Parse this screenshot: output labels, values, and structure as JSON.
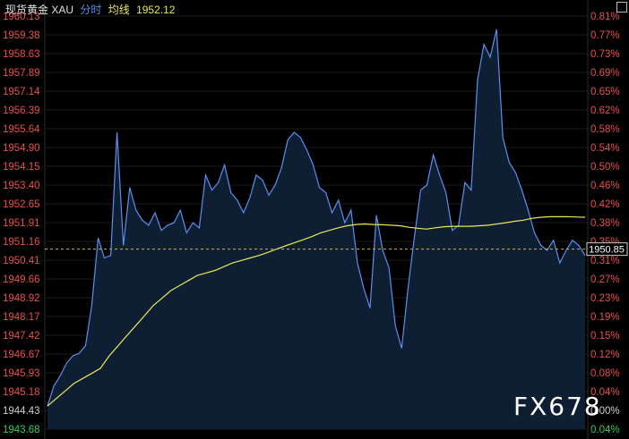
{
  "header": {
    "instrument": "现货黄金 XAU",
    "tab_intraday": "分时",
    "avg_label": "均线",
    "avg_value": "1952.12"
  },
  "watermark": "FX678",
  "colors": {
    "background": "#000000",
    "price_line": "#5b8ff0",
    "avg_line": "#e8e85a",
    "up_axis": "#e8504d",
    "down_axis": "#2fcf5c",
    "neutral_axis": "#cfcfcf",
    "ref_line": "#d6b04a",
    "fill": "#0f1f33"
  },
  "chart_data": {
    "type": "line",
    "title": "现货黄金 XAU",
    "ylim": [
      1943.68,
      1960.13
    ],
    "prev_close": 1944.43,
    "last_price": "1950.85",
    "left_ticks": [
      "1960.13",
      "1959.38",
      "1958.63",
      "1957.89",
      "1957.14",
      "1956.39",
      "1955.64",
      "1954.90",
      "1954.15",
      "1953.40",
      "1952.65",
      "1951.91",
      "1951.16",
      "1950.41",
      "1949.66",
      "1948.92",
      "1948.17",
      "1947.42",
      "1946.67",
      "1945.93",
      "1945.18",
      "1944.43",
      "1943.68"
    ],
    "right_ticks": [
      "0.81%",
      "0.77%",
      "0.73%",
      "0.69%",
      "0.65%",
      "0.62%",
      "0.58%",
      "0.54%",
      "0.50%",
      "0.46%",
      "0.42%",
      "0.38%",
      "0.35%",
      "0.31%",
      "0.27%",
      "0.23%",
      "0.19%",
      "0.15%",
      "0.12%",
      "0.08%",
      "0.04%",
      "0.00%",
      "0.04%"
    ],
    "series": [
      {
        "values": [
          1944.6,
          1945.4,
          1945.8,
          1946.3,
          1946.6,
          1946.7,
          1947.0,
          1948.6,
          1951.3,
          1950.5,
          1950.6,
          1955.5,
          1951.0,
          1953.3,
          1952.4,
          1952.0,
          1951.8,
          1952.3,
          1951.6,
          1951.8,
          1951.9,
          1952.4,
          1951.5,
          1951.9,
          1951.7,
          1953.8,
          1953.2,
          1953.5,
          1954.2,
          1953.1,
          1952.8,
          1952.3,
          1952.9,
          1953.8,
          1953.6,
          1953.0,
          1953.4,
          1954.1,
          1955.2,
          1955.5,
          1955.3,
          1954.8,
          1954.2,
          1953.3,
          1953.1,
          1952.3,
          1952.8,
          1951.9,
          1952.4,
          1950.3,
          1949.3,
          1948.5,
          1952.2,
          1950.8,
          1950.1,
          1947.8,
          1946.9,
          1949.3,
          1951.3,
          1953.2,
          1953.4,
          1954.6,
          1953.8,
          1953.1,
          1951.6,
          1951.8,
          1953.5,
          1953.2,
          1957.6,
          1959.0,
          1958.5,
          1959.6,
          1955.3,
          1954.3,
          1953.9,
          1953.2,
          1952.4,
          1951.5,
          1951.0,
          1950.8,
          1951.2,
          1950.3,
          1950.8,
          1951.2,
          1951.0,
          1950.6
        ],
        "avg": [
          1944.6,
          1944.9,
          1945.2,
          1945.5,
          1945.7,
          1945.9,
          1946.1,
          1946.6,
          1947.0,
          1947.4,
          1947.8,
          1948.2,
          1948.6,
          1948.9,
          1949.2,
          1949.4,
          1949.6,
          1949.8,
          1949.9,
          1950.0,
          1950.15,
          1950.3,
          1950.4,
          1950.5,
          1950.6,
          1950.72,
          1950.85,
          1950.98,
          1951.1,
          1951.22,
          1951.35,
          1951.5,
          1951.6,
          1951.7,
          1951.78,
          1951.83,
          1951.85,
          1951.83,
          1951.82,
          1951.8,
          1951.78,
          1951.72,
          1951.68,
          1951.65,
          1951.7,
          1951.74,
          1951.76,
          1951.76,
          1951.76,
          1951.78,
          1951.8,
          1951.85,
          1951.9,
          1951.96,
          1952.0,
          1952.08,
          1952.12,
          1952.14,
          1952.14,
          1952.14,
          1952.13,
          1952.12
        ]
      }
    ]
  }
}
